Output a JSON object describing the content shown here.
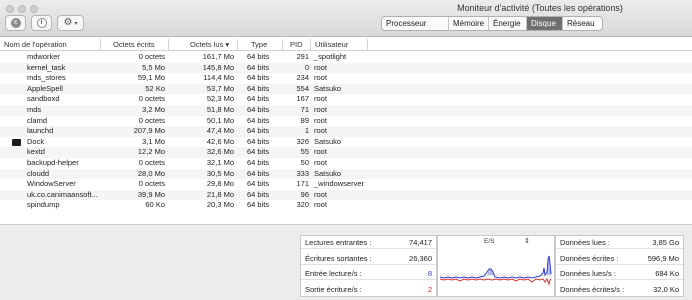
{
  "window": {
    "title": "Moniteur d'activité (Toutes les opérations)"
  },
  "toolbar": {
    "stop_icon": "x",
    "info_icon": "i",
    "gear_icon": "⚙",
    "chevron_icon": "▾",
    "tabs": [
      {
        "label": "Processeur",
        "active": false
      },
      {
        "label": "Mémoire",
        "active": false
      },
      {
        "label": "Énergie",
        "active": false
      },
      {
        "label": "Disque",
        "active": true
      },
      {
        "label": "Réseau",
        "active": false
      }
    ]
  },
  "columns": {
    "name": "Nom de l'opération",
    "written": "Octets écrits",
    "read": "Octets lus",
    "sort_arrow": "▾",
    "type": "Type",
    "pid": "PID",
    "user": "Utilisateur"
  },
  "processes": [
    {
      "name": "mdworker",
      "written": "0 octets",
      "read": "161,7 Mo",
      "type": "64 bits",
      "pid": "291",
      "user": "_spotlight"
    },
    {
      "name": "kernel_task",
      "written": "5,5 Mo",
      "read": "145,8 Mo",
      "type": "64 bits",
      "pid": "0",
      "user": "root"
    },
    {
      "name": "mds_stores",
      "written": "59,1 Mo",
      "read": "114,4 Mo",
      "type": "64 bits",
      "pid": "234",
      "user": "root"
    },
    {
      "name": "AppleSpell",
      "written": "52 Ko",
      "read": "53,7 Mo",
      "type": "64 bits",
      "pid": "554",
      "user": "Satsuko"
    },
    {
      "name": "sandboxd",
      "written": "0 octets",
      "read": "52,3 Mo",
      "type": "64 bits",
      "pid": "167",
      "user": "root"
    },
    {
      "name": "mds",
      "written": "3,2 Mo",
      "read": "51,8 Mo",
      "type": "64 bits",
      "pid": "71",
      "user": "root"
    },
    {
      "name": "clamd",
      "written": "0 octets",
      "read": "50,1 Mo",
      "type": "64 bits",
      "pid": "89",
      "user": "root"
    },
    {
      "name": "launchd",
      "written": "207,9 Mo",
      "read": "47,4 Mo",
      "type": "64 bits",
      "pid": "1",
      "user": "root"
    },
    {
      "name": "Dock",
      "written": "3,1 Mo",
      "read": "42,6 Mo",
      "type": "64 bits",
      "pid": "326",
      "user": "Satsuko",
      "icon": "dock-app-icon"
    },
    {
      "name": "kextd",
      "written": "12,2 Mo",
      "read": "32,6 Mo",
      "type": "64 bits",
      "pid": "55",
      "user": "root"
    },
    {
      "name": "backupd-helper",
      "written": "0 octets",
      "read": "32,1 Mo",
      "type": "64 bits",
      "pid": "50",
      "user": "root"
    },
    {
      "name": "cloudd",
      "written": "28,0 Mo",
      "read": "30,5 Mo",
      "type": "64 bits",
      "pid": "333",
      "user": "Satsuko"
    },
    {
      "name": "WindowServer",
      "written": "0 octets",
      "read": "29,8 Mo",
      "type": "64 bits",
      "pid": "171",
      "user": "_windowserver"
    },
    {
      "name": "uk.co.canimaansoft...",
      "written": "39,9 Mo",
      "read": "21,8 Mo",
      "type": "64 bits",
      "pid": "96",
      "user": "root"
    },
    {
      "name": "spindump",
      "written": "60 Ko",
      "read": "20,3 Mo",
      "type": "64 bits",
      "pid": "320",
      "user": "root"
    }
  ],
  "stats_left": [
    {
      "label": "Lectures entrantes :",
      "value": "74,417",
      "color": ""
    },
    {
      "label": "Écritures sortantes :",
      "value": "26,360",
      "color": ""
    },
    {
      "label": "Entrée lecture/s :",
      "value": "8",
      "color": "blue"
    },
    {
      "label": "Sortie écriture/s :",
      "value": "2",
      "color": "red"
    }
  ],
  "graph": {
    "title": "E/S",
    "toggle_icon": "⇕",
    "colors": {
      "read": "#2f3bd1",
      "write": "#d12f2f"
    }
  },
  "stats_right": [
    {
      "label": "Données lues :",
      "value": "3,85 Go"
    },
    {
      "label": "Données écrites :",
      "value": "596,9 Mo"
    },
    {
      "label": "Données lues/s :",
      "value": "684 Ko"
    },
    {
      "label": "Données écrites/s :",
      "value": "32,0 Ko"
    }
  ]
}
